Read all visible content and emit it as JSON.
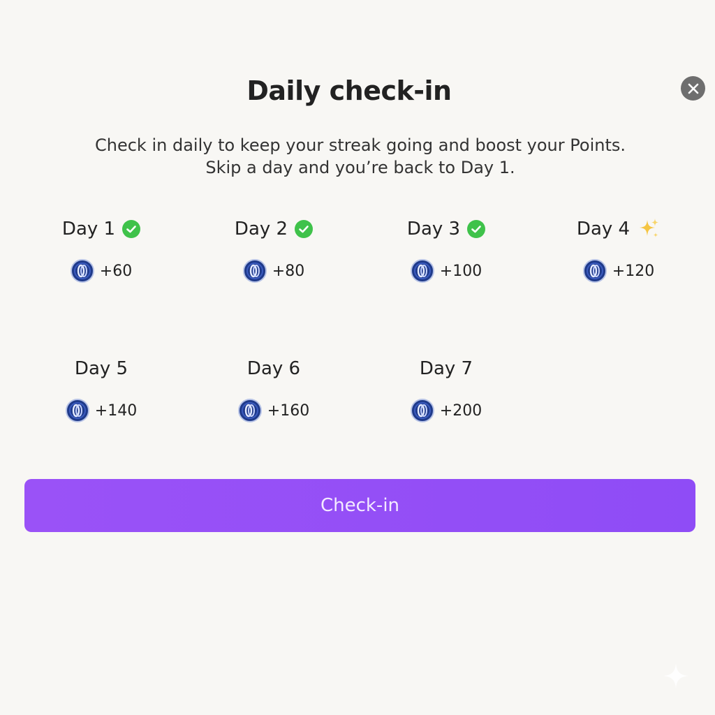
{
  "dialog": {
    "title": "Daily check-in",
    "description_line1": "Check in daily to keep your streak going and boost your Points.",
    "description_line2": "Skip a day and you’re back to Day 1.",
    "button_label": "Check-in"
  },
  "days": [
    {
      "label": "Day 1",
      "reward": "+60",
      "status": "completed"
    },
    {
      "label": "Day 2",
      "reward": "+80",
      "status": "completed"
    },
    {
      "label": "Day 3",
      "reward": "+100",
      "status": "completed"
    },
    {
      "label": "Day 4",
      "reward": "+120",
      "status": "today"
    },
    {
      "label": "Day 5",
      "reward": "+140",
      "status": "upcoming"
    },
    {
      "label": "Day 6",
      "reward": "+160",
      "status": "upcoming"
    },
    {
      "label": "Day 7",
      "reward": "+200",
      "status": "upcoming"
    }
  ],
  "icons": {
    "completed": "check-circle-icon",
    "today": "sparkle-icon",
    "coin": "points-coin-icon",
    "close": "close-icon"
  },
  "colors": {
    "accent": "#9450f6",
    "check_green": "#3fc24a",
    "sparkle_gold": "#f5c542",
    "coin_blue": "#1f3a8a"
  }
}
